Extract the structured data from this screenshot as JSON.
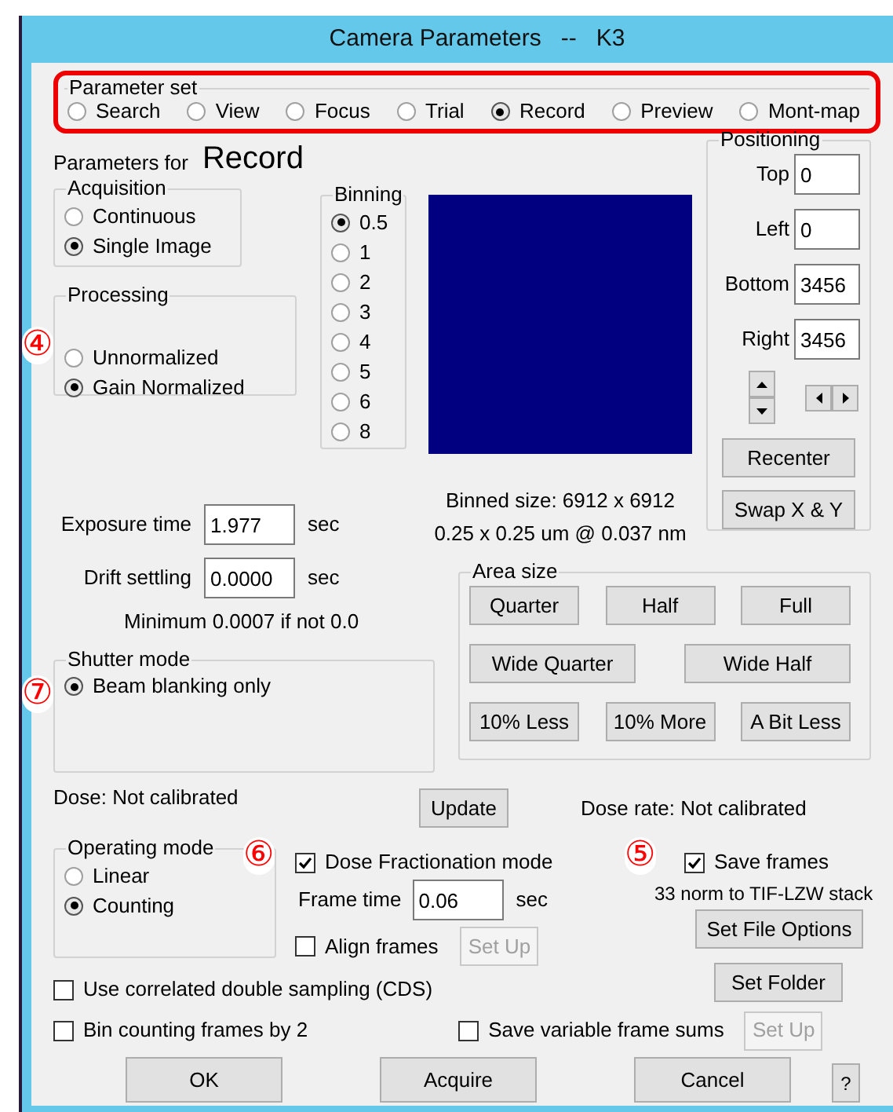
{
  "window": {
    "title": "Camera Parameters   --   K3"
  },
  "parameter_set": {
    "label": "Parameter set",
    "options": [
      {
        "label": "Search",
        "selected": false
      },
      {
        "label": "View",
        "selected": false
      },
      {
        "label": "Focus",
        "selected": false
      },
      {
        "label": "Trial",
        "selected": false
      },
      {
        "label": "Record",
        "selected": true
      },
      {
        "label": "Preview",
        "selected": false
      },
      {
        "label": "Mont-map",
        "selected": false
      }
    ]
  },
  "parameters_for": {
    "label": "Parameters for",
    "value": "Record"
  },
  "acquisition": {
    "label": "Acquisition",
    "options": [
      {
        "label": "Continuous",
        "selected": false
      },
      {
        "label": "Single Image",
        "selected": true
      }
    ]
  },
  "processing": {
    "label": "Processing",
    "annotation": "④",
    "options": [
      {
        "label": "Unnormalized",
        "selected": false
      },
      {
        "label": "Gain Normalized",
        "selected": true
      }
    ]
  },
  "binning": {
    "label": "Binning",
    "options": [
      {
        "label": "0.5",
        "selected": true
      },
      {
        "label": "1",
        "selected": false
      },
      {
        "label": "2",
        "selected": false
      },
      {
        "label": "3",
        "selected": false
      },
      {
        "label": "4",
        "selected": false
      },
      {
        "label": "5",
        "selected": false
      },
      {
        "label": "6",
        "selected": false
      },
      {
        "label": "8",
        "selected": false
      }
    ]
  },
  "positioning": {
    "label": "Positioning",
    "fields": [
      {
        "label": "Top",
        "value": "0"
      },
      {
        "label": "Left",
        "value": "0"
      },
      {
        "label": "Bottom",
        "value": "3456"
      },
      {
        "label": "Right",
        "value": "3456"
      }
    ],
    "buttons": [
      "Recenter",
      "Swap X & Y"
    ]
  },
  "binned_info": [
    "Binned size: 6912 x 6912",
    "0.25 x 0.25 um @ 0.037 nm"
  ],
  "exposure": {
    "label": "Exposure time",
    "value": "1.977",
    "unit": "sec"
  },
  "drift": {
    "label": "Drift settling",
    "value": "0.0000",
    "unit": "sec"
  },
  "minimum_note": "Minimum 0.0007 if not 0.0",
  "shutter_mode": {
    "label": "Shutter mode",
    "annotation": "⑦",
    "options": [
      {
        "label": "Beam blanking only",
        "selected": true
      }
    ]
  },
  "area_size": {
    "label": "Area size",
    "buttons": [
      "Quarter",
      "Half",
      "Full",
      "Wide Quarter",
      "Wide Half",
      "10% Less",
      "10% More",
      "A Bit Less"
    ]
  },
  "dose": "Dose: Not calibrated",
  "update_button": "Update",
  "dose_rate": "Dose rate: Not calibrated",
  "operating_mode": {
    "label": "Operating mode",
    "options": [
      {
        "label": "Linear",
        "selected": false
      },
      {
        "label": "Counting",
        "selected": true
      }
    ]
  },
  "dose_fractionation": {
    "annotation": "⑥",
    "label": "Dose Fractionation mode",
    "checked": true
  },
  "frame_time": {
    "label": "Frame time",
    "value": "0.06",
    "unit": "sec"
  },
  "align_frames": {
    "label": "Align frames",
    "checked": false,
    "setup": {
      "label": "Set Up",
      "disabled": true
    }
  },
  "save_frames": {
    "annotation": "⑤",
    "label": "Save frames",
    "checked": true,
    "note": "33 norm to TIF-LZW stack",
    "buttons": [
      "Set File Options",
      "Set Folder"
    ]
  },
  "cds": {
    "label": "Use correlated double sampling (CDS)",
    "checked": false
  },
  "bin_counting": {
    "label": "Bin counting frames by 2",
    "checked": false
  },
  "save_variable": {
    "label": "Save variable frame sums",
    "checked": false,
    "setup": {
      "label": "Set Up",
      "disabled": true
    }
  },
  "footer_buttons": [
    "OK",
    "Acquire",
    "Cancel",
    "?"
  ]
}
